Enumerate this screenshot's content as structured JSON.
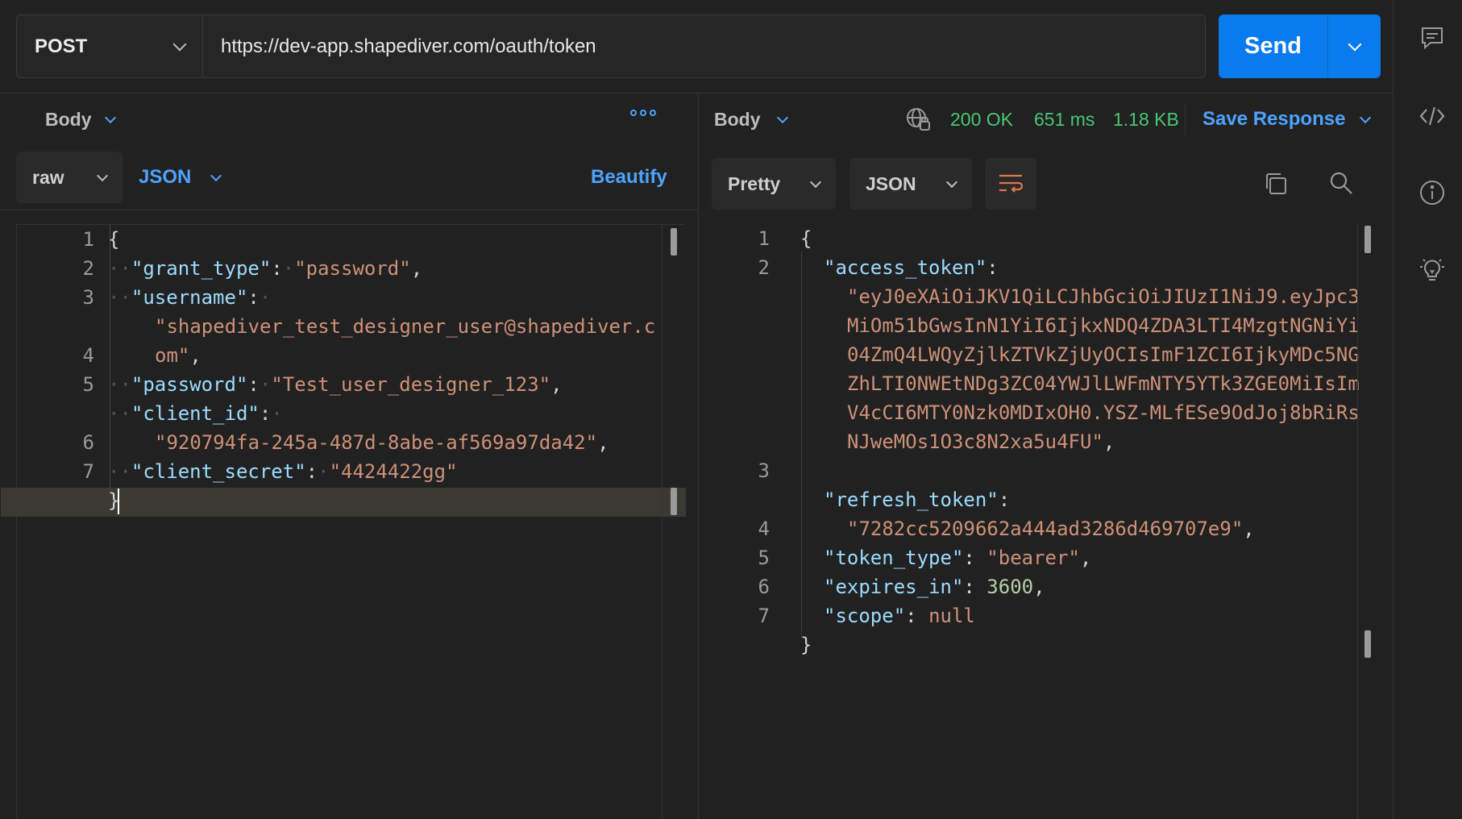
{
  "request": {
    "method": "POST",
    "url": "https://dev-app.shapediver.com/oauth/token",
    "send_label": "Send"
  },
  "req_panel": {
    "tab": "Body",
    "mode": "raw",
    "format": "JSON",
    "beautify": "Beautify",
    "line_numbers": [
      "1",
      "2",
      "3",
      "",
      "4",
      "5",
      "",
      "6",
      "7"
    ]
  },
  "resp_panel": {
    "tab": "Body",
    "status": "200 OK",
    "time": "651 ms",
    "size": "1.18 KB",
    "save_label": "Save Response",
    "view": "Pretty",
    "format": "JSON",
    "line_numbers": [
      "1",
      "2",
      "",
      "",
      "",
      "",
      "",
      "",
      "3",
      "",
      "4",
      "5",
      "6",
      "7"
    ]
  },
  "request_body": {
    "grant_type": "password",
    "username": "shapediver_test_designer_user@shapediver.com",
    "password": "Test_user_designer_123",
    "client_id": "920794fa-245a-487d-8abe-af569a97da42",
    "client_secret": "4424422gg"
  },
  "response_body": {
    "access_token": "eyJ0eXAiOiJKV1QiLCJhbGciOiJIUzI1NiJ9.eyJpc3MiOm51bGwsInN1YiI6IjkxNDQ4ZDA3LTI4MzgtNGNiYi04ZmQ4LWQyZjlkZTVkZjUyOCIsImF1ZCI6IjkyMDc5NGZhLTI0NWEtNDg3ZC04YWJlLWFmNTY5YTk3ZGE0MiIsImV4cCI6MTY0Nzk0MDIxOH0.YSZ-MLfESe9OdJoj8bRiRsNJweMOs1O3c8N2xa5u4FU",
    "refresh_token": "7282cc5209662a444ad3286d469707e9",
    "token_type": "bearer",
    "expires_in": "3600",
    "scope": "null"
  },
  "icons": {
    "rail": [
      "comment-icon",
      "code-icon",
      "info-icon",
      "lightbulb-icon"
    ],
    "toolbar": [
      "globe-icon",
      "wrap-icon",
      "copy-icon",
      "search-icon",
      "more-icon"
    ]
  },
  "colors": {
    "accent": "#097bed",
    "status_ok": "#48c774",
    "json_key": "#9cdcfe",
    "json_string": "#ce9178",
    "json_number": "#b5cea8"
  }
}
